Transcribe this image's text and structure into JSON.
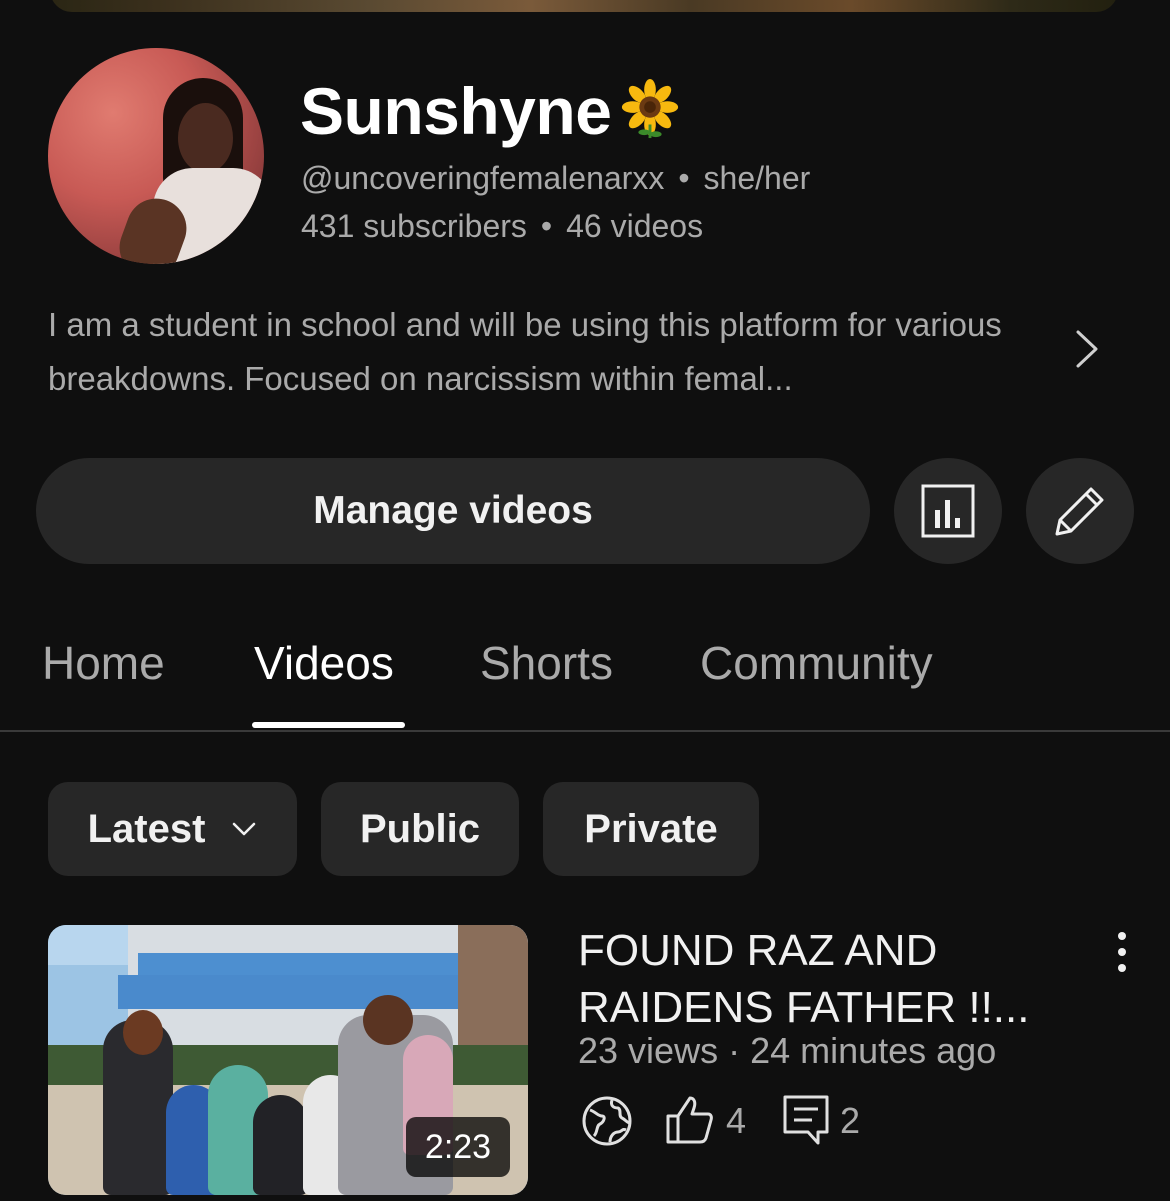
{
  "channel": {
    "name": "Sunshyne",
    "name_emoji_icon": "sunflower-icon",
    "handle": "@uncoveringfemalenarxx",
    "pronouns": "she/her",
    "subscribers": "431 subscribers",
    "videos_count": "46 videos",
    "description": "I am a student in school and will be using this platform for various breakdowns. Focused on narcissism within femal..."
  },
  "actions": {
    "manage_videos": "Manage videos",
    "stats_icon": "analytics-icon",
    "edit_icon": "pencil-icon"
  },
  "tabs": [
    {
      "label": "Home",
      "active": false
    },
    {
      "label": "Videos",
      "active": true
    },
    {
      "label": "Shorts",
      "active": false
    },
    {
      "label": "Community",
      "active": false
    }
  ],
  "filters": {
    "sort": "Latest",
    "public": "Public",
    "private": "Private"
  },
  "videos": [
    {
      "title": "FOUND RAZ AND RAIDENS FATHER !!...",
      "views": "23 views",
      "age": "24 minutes ago",
      "duration": "2:23",
      "visibility_icon": "globe-icon",
      "likes": "4",
      "comments": "2"
    }
  ],
  "colors": {
    "background": "#0f0f0f",
    "surface": "#272727",
    "text_primary": "#f1f1f1",
    "text_secondary": "#aaaaaa"
  }
}
